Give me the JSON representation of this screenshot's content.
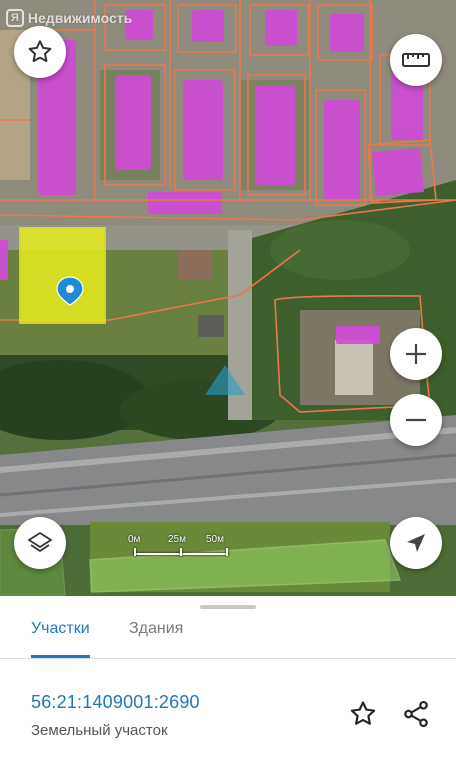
{
  "map": {
    "watermark_badge": "Я",
    "watermark_text": "Недвижимость",
    "scale_labels": [
      "0м",
      "25м",
      "50м"
    ]
  },
  "buttons": {
    "favorite": "star-outline-icon",
    "ruler": "ruler-icon",
    "zoom_in": "plus-icon",
    "zoom_out": "minus-icon",
    "layers": "layers-icon",
    "locate": "navigation-arrow-icon"
  },
  "tabs": [
    {
      "label": "Участки",
      "active": true
    },
    {
      "label": "Здания",
      "active": false
    }
  ],
  "parcel": {
    "cadastral_number": "56:21:1409001:2690",
    "type": "Земельный участок"
  },
  "colors": {
    "accent": "#1b7bbf",
    "building_highlight": "#d04bd6",
    "parcel_highlight": "#e8ee1e",
    "boundary": "#e8794a"
  }
}
